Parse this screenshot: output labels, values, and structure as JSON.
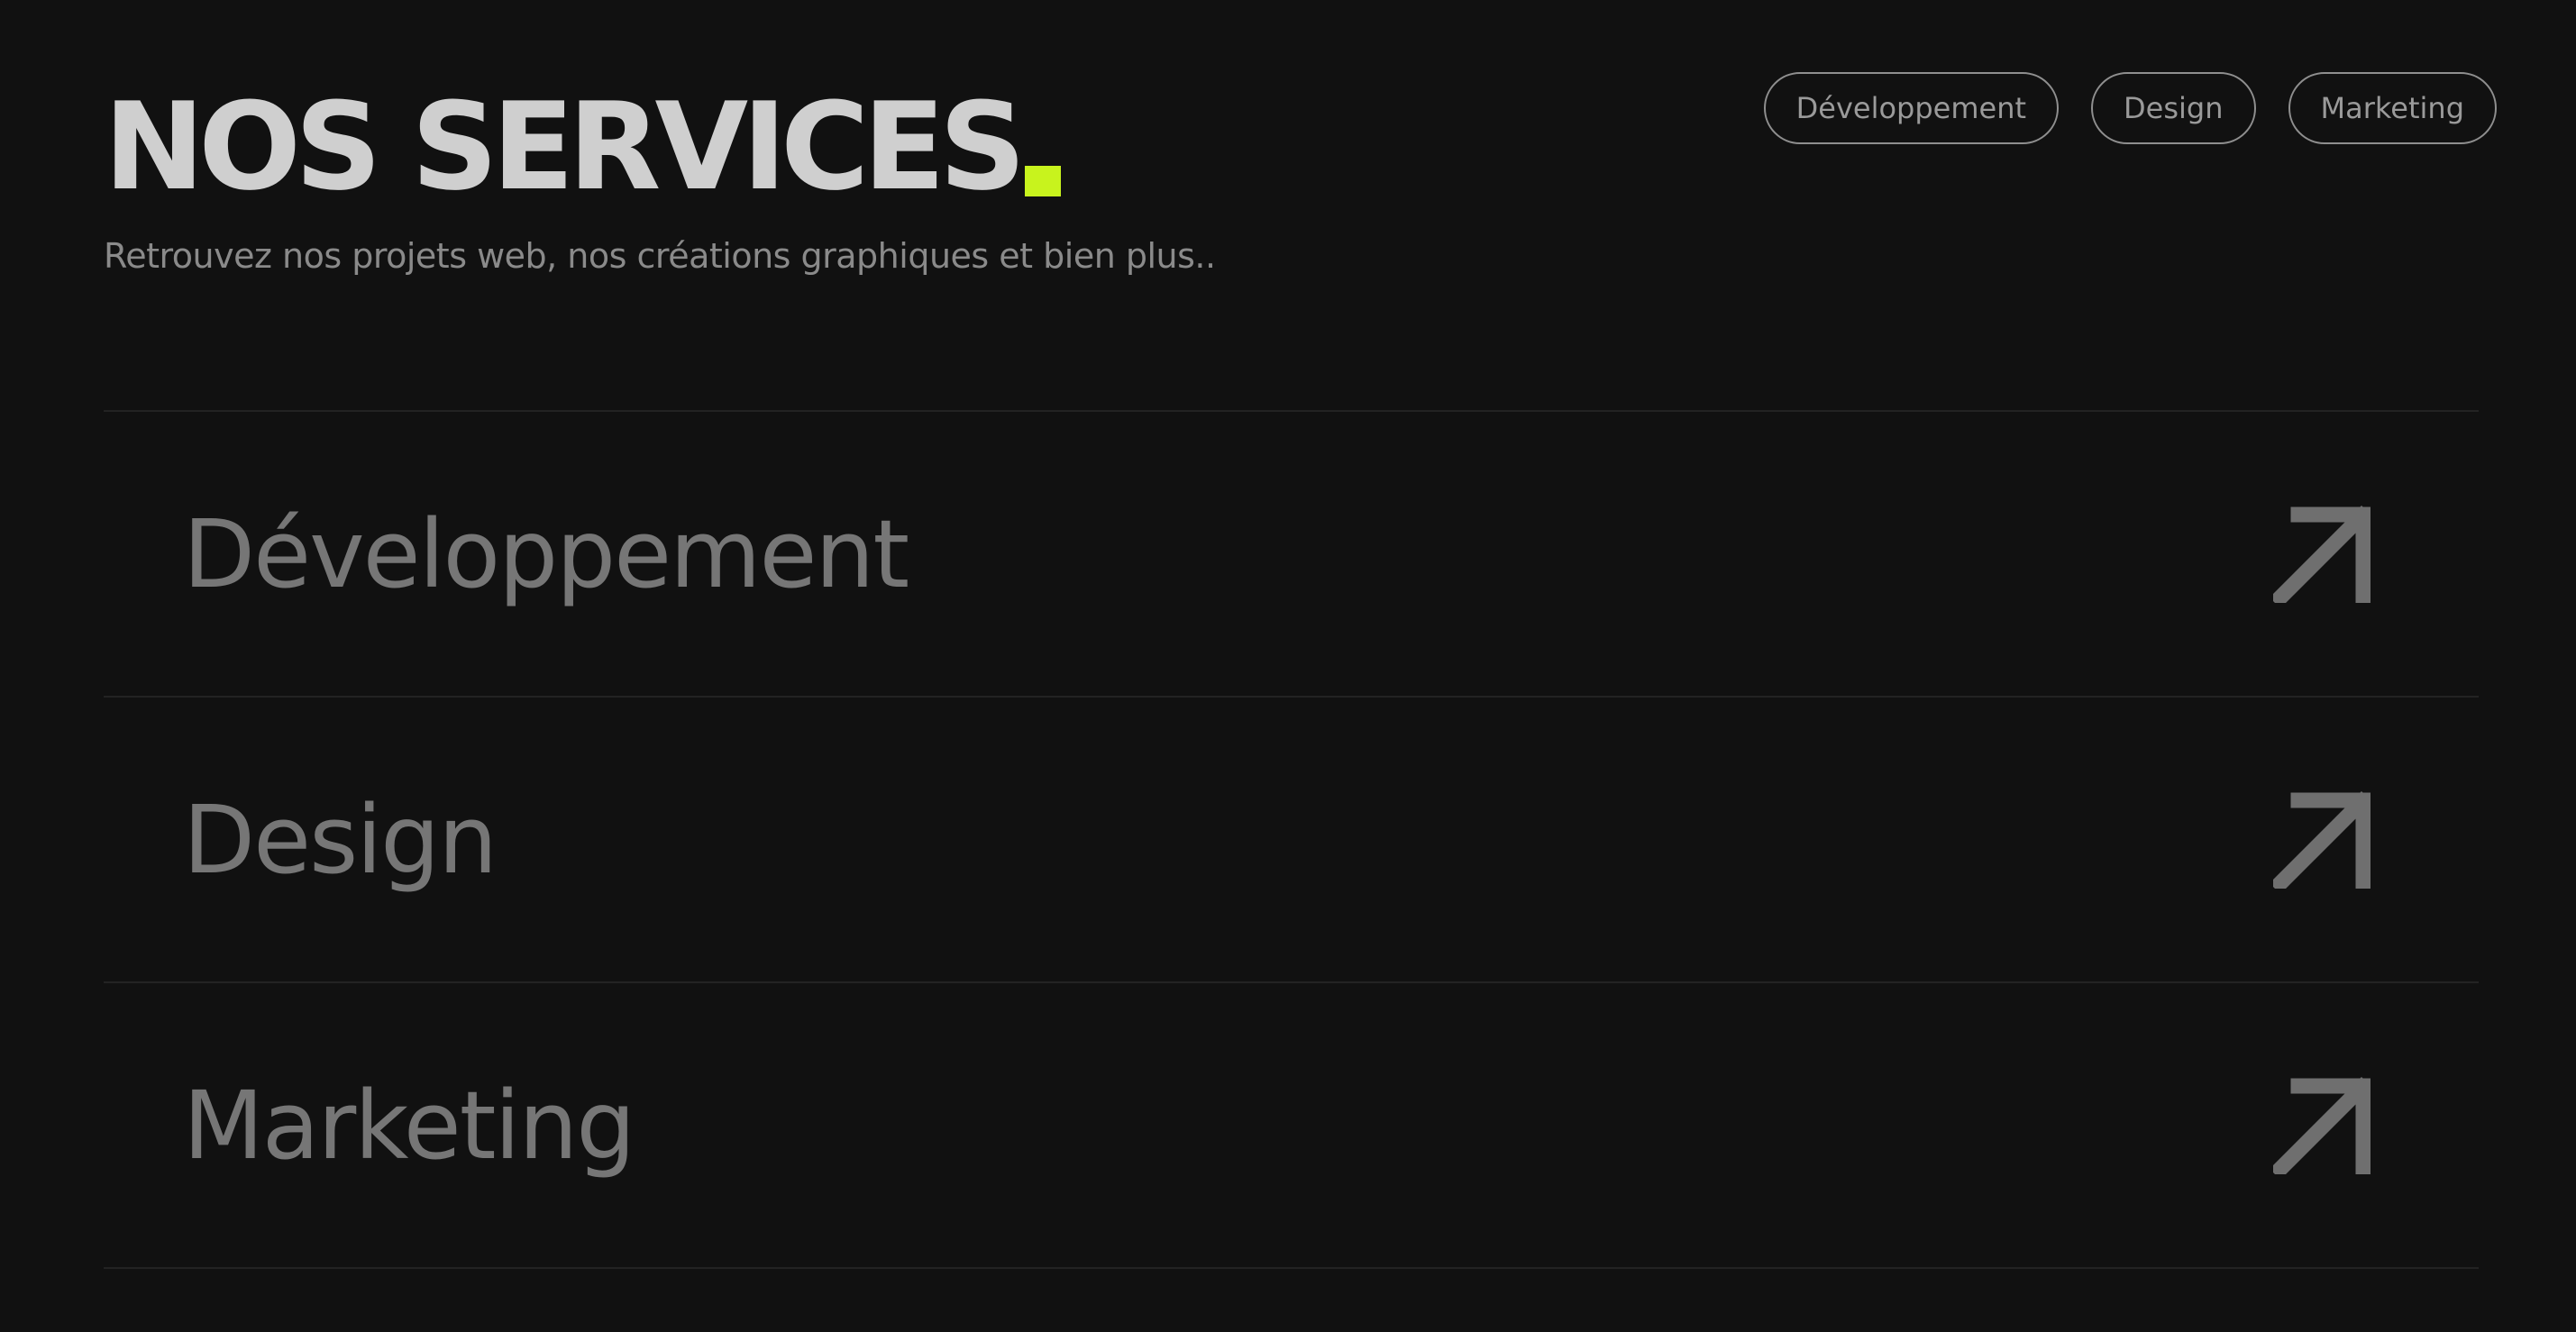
{
  "header": {
    "title": "NOS SERVICES",
    "subtitle": "Retrouvez nos projets web, nos créations graphiques et bien plus..",
    "accent_dot_icon": "square-dot-icon"
  },
  "filters": [
    {
      "label": "Développement"
    },
    {
      "label": "Design"
    },
    {
      "label": "Marketing"
    }
  ],
  "services": [
    {
      "label": "Développement",
      "icon": "arrow-up-right-icon"
    },
    {
      "label": "Design",
      "icon": "arrow-up-right-icon"
    },
    {
      "label": "Marketing",
      "icon": "arrow-up-right-icon"
    }
  ],
  "colors": {
    "background": "#111111",
    "title": "#cfcfcf",
    "accent": "#c8f31d",
    "muted_text": "#767676",
    "chip_border": "#8f8f8f",
    "divider": "#232323"
  }
}
